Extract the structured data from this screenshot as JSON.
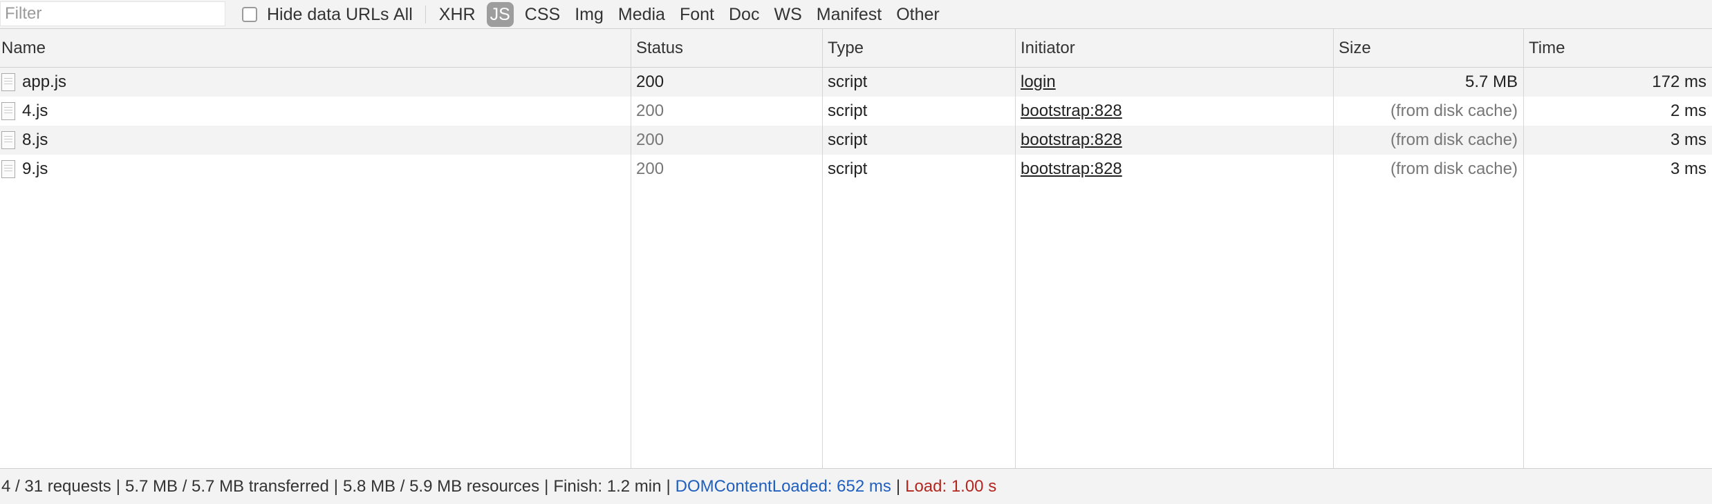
{
  "toolbar": {
    "filter_placeholder": "Filter",
    "hide_data_urls_label": "Hide data URLs",
    "hide_data_urls_checked": false,
    "types": [
      "All",
      "XHR",
      "JS",
      "CSS",
      "Img",
      "Media",
      "Font",
      "Doc",
      "WS",
      "Manifest",
      "Other"
    ],
    "active_type": "JS"
  },
  "table": {
    "columns": {
      "name": "Name",
      "status": "Status",
      "type": "Type",
      "initiator": "Initiator",
      "size": "Size",
      "time": "Time"
    },
    "rows": [
      {
        "name": "app.js",
        "status": "200",
        "type": "script",
        "initiator": "login",
        "size": "5.7 MB",
        "time": "172 ms"
      },
      {
        "name": "4.js",
        "status": "200",
        "type": "script",
        "initiator": "bootstrap:828",
        "size": "(from disk cache)",
        "time": "2 ms"
      },
      {
        "name": "8.js",
        "status": "200",
        "type": "script",
        "initiator": "bootstrap:828",
        "size": "(from disk cache)",
        "time": "3 ms"
      },
      {
        "name": "9.js",
        "status": "200",
        "type": "script",
        "initiator": "bootstrap:828",
        "size": "(from disk cache)",
        "time": "3 ms"
      }
    ]
  },
  "status_bar": {
    "requests": "4 / 31 requests",
    "transferred": "5.7 MB / 5.7 MB transferred",
    "resources": "5.8 MB / 5.9 MB resources",
    "finish": "Finish: 1.2 min",
    "dom_content_loaded": "DOMContentLoaded: 652 ms",
    "load": "Load: 1.00 s",
    "separator": "|"
  },
  "colors": {
    "dom_content_loaded": "#1f5fbf",
    "load": "#b3261e",
    "active_type_bg": "#9d9d9d"
  },
  "icons": {
    "row_icon": "document-file-icon"
  }
}
